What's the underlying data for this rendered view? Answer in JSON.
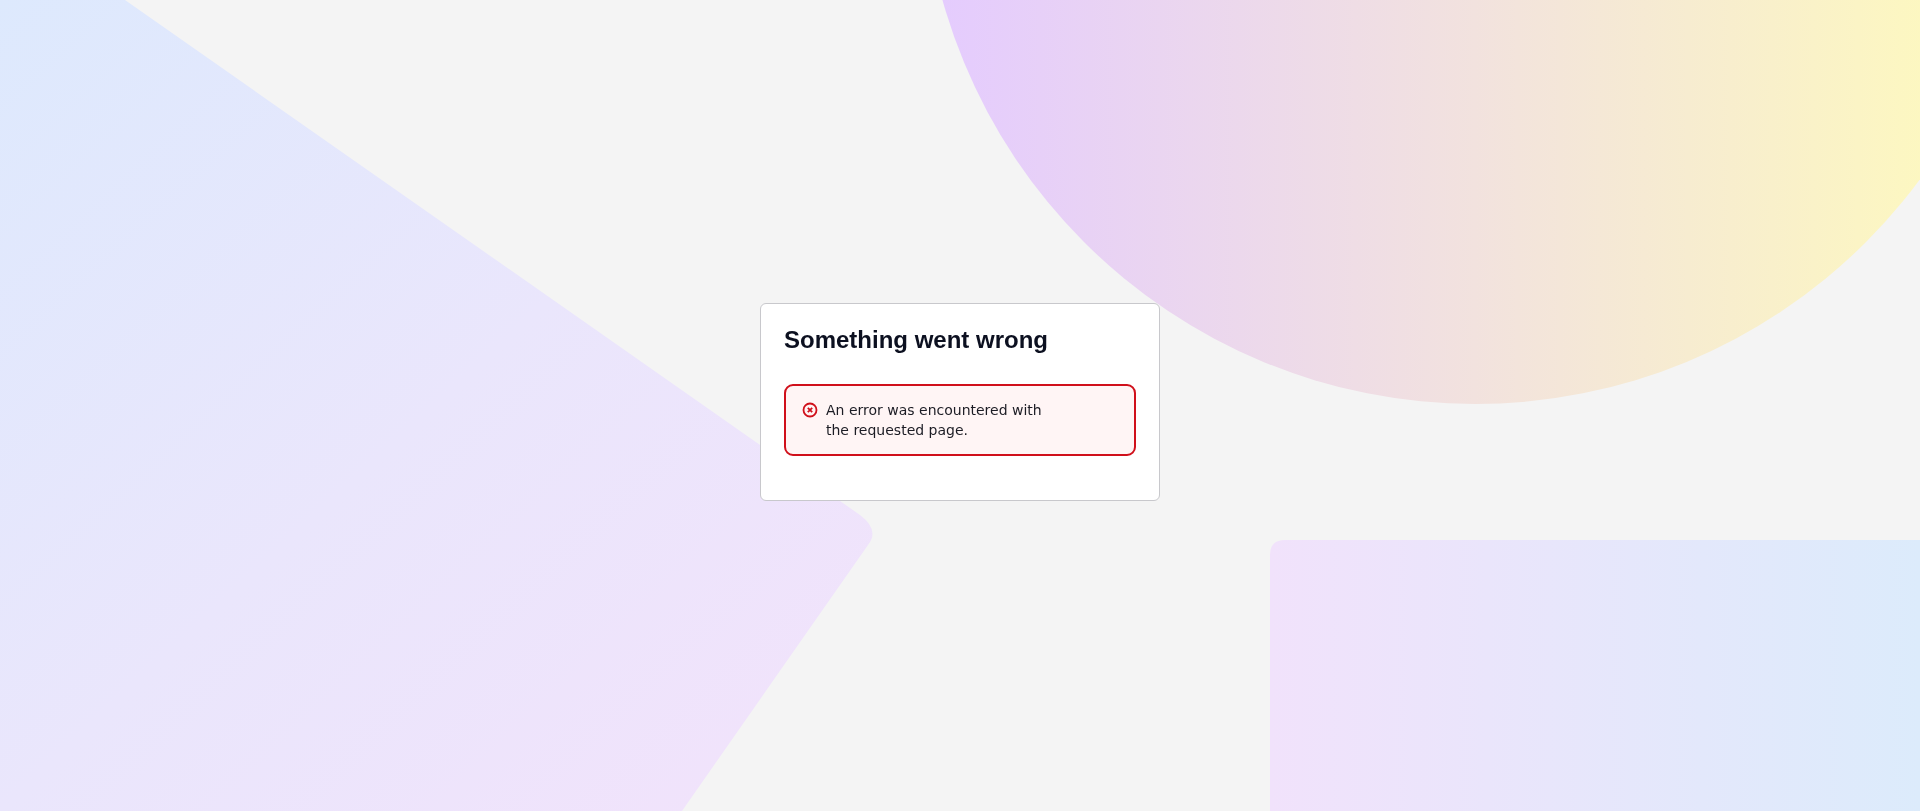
{
  "dialog": {
    "title": "Something went wrong",
    "alert": {
      "kind": "error",
      "message": "An error was encountered with the requested page."
    }
  }
}
